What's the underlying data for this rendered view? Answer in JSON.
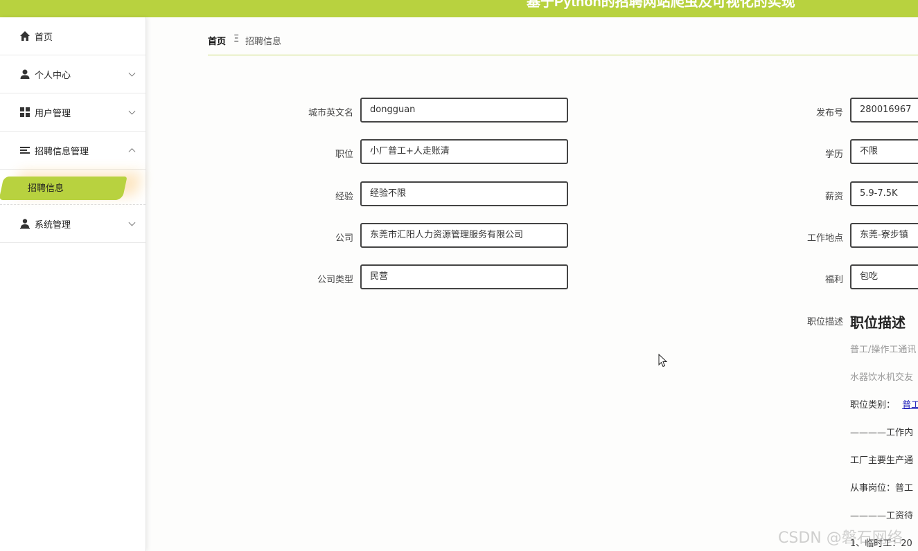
{
  "header": {
    "title": "基于Python的招聘网站爬虫及可视化的实现"
  },
  "sidebar": {
    "items": [
      {
        "label": "首页",
        "icon": "home-icon",
        "expandable": false
      },
      {
        "label": "个人中心",
        "icon": "user-icon",
        "expandable": true
      },
      {
        "label": "用户管理",
        "icon": "grid-icon",
        "expandable": true
      },
      {
        "label": "招聘信息管理",
        "icon": "list-icon",
        "expandable": true,
        "expanded": true
      },
      {
        "label": "系统管理",
        "icon": "admin-icon",
        "expandable": true
      }
    ],
    "submenu": {
      "label": "招聘信息",
      "active": true
    }
  },
  "breadcrumb": {
    "home": "首页",
    "separator": "Ξ",
    "current": "招聘信息"
  },
  "form": {
    "left": [
      {
        "label": "城市英文名",
        "value": "dongguan"
      },
      {
        "label": "职位",
        "value": "小厂普工+人走账清"
      },
      {
        "label": "经验",
        "value": "经验不限"
      },
      {
        "label": "公司",
        "value": "东莞市汇阳人力资源管理服务有限公司"
      },
      {
        "label": "公司类型",
        "value": "民营"
      }
    ],
    "right": [
      {
        "label": "发布号",
        "value": "280016967"
      },
      {
        "label": "学历",
        "value": "不限"
      },
      {
        "label": "薪资",
        "value": "5.9-7.5K"
      },
      {
        "label": "工作地点",
        "value": "东莞-寮步镇"
      },
      {
        "label": "福利",
        "value": "包吃"
      }
    ],
    "description": {
      "label": "职位描述",
      "title": "职位描述",
      "lines": [
        "普工/操作工通讯",
        "水器饮水机交友",
        "职位类别：",
        "————工作内",
        "工厂主要生产通",
        "从事岗位：普工",
        "————工资待",
        "1、临时工：20"
      ],
      "category_link": "普工"
    }
  },
  "watermark": "CSDN @磐石网络",
  "colors": {
    "accent": "#b8d23f"
  }
}
